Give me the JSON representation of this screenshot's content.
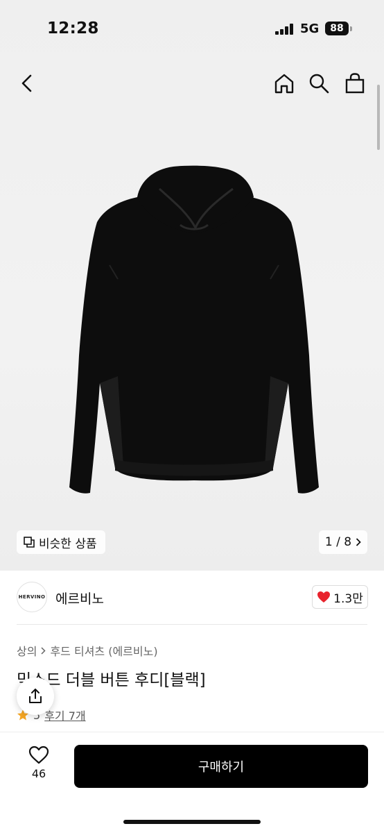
{
  "status_bar": {
    "time": "12:28",
    "network": "5G",
    "battery": "88"
  },
  "nav": {
    "icons": [
      "chevron-left-icon",
      "home-icon",
      "search-icon",
      "shopping-bag-icon"
    ]
  },
  "gallery": {
    "similar_label": "비슷한 상품",
    "page_indicator": "1 / 8"
  },
  "brand": {
    "logo_text": "HERVINO",
    "name": "에르비노",
    "likes": "1.3만"
  },
  "breadcrumb": {
    "level1": "상의",
    "level2": "후드 티셔츠 (에르비노)"
  },
  "product": {
    "title": "믹스드 더블 버튼 후디[블랙]",
    "rating_visible": "5",
    "reviews": "후기 7개"
  },
  "bottom": {
    "wish_count": "46",
    "buy_label": "구매하기"
  },
  "colors": {
    "accent_heart": "#e8232d",
    "buy_button": "#000000",
    "star": "#f5a623"
  }
}
